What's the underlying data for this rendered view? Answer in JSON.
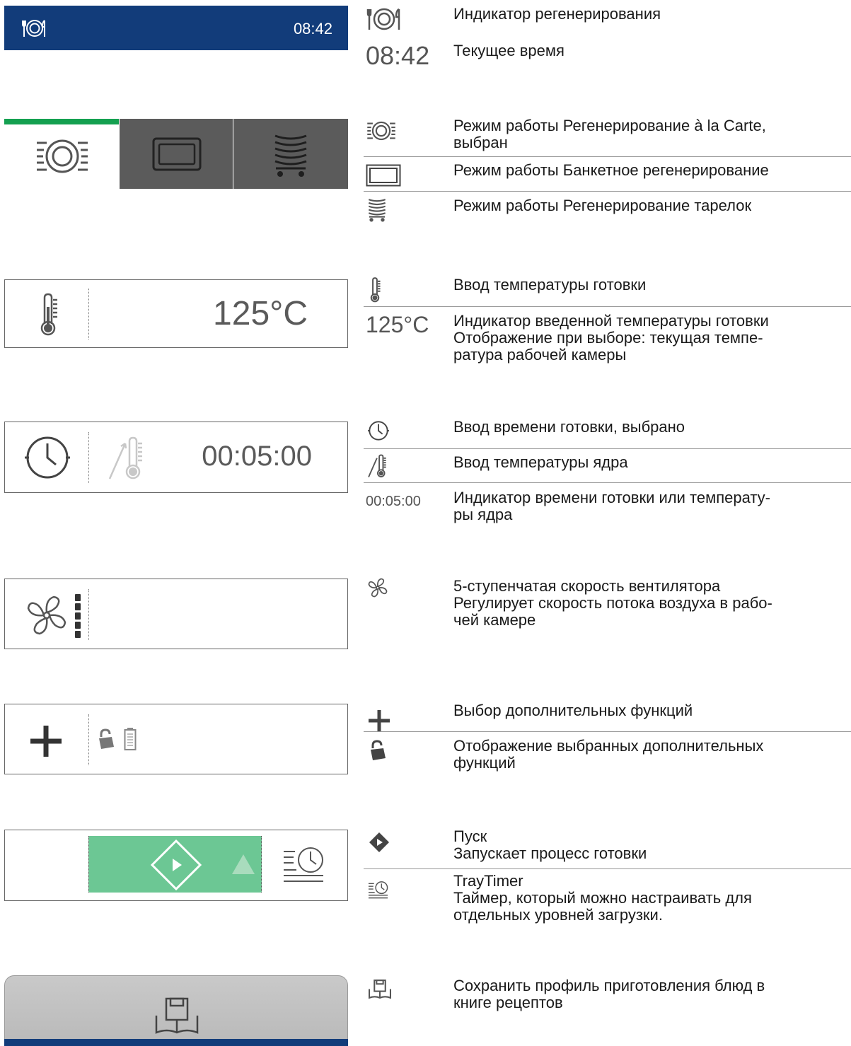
{
  "header": {
    "time": "08:42",
    "icon": "plate-cutlery-icon"
  },
  "temperature_panel": {
    "value": "125°C"
  },
  "time_panel": {
    "value": "00:05:00"
  },
  "legend": {
    "regen_indicator": "Индикатор регенерирования",
    "current_time_value": "08:42",
    "current_time": "Текущее время",
    "mode_alacarte": "Режим работы Регенерирование à la Carte,\nвыбран",
    "mode_banquet": "Режим работы Банкетное регенерирование",
    "mode_plate": "Режим работы Регенерирование тарелок",
    "temp_input": "Ввод температуры готовки",
    "temp_value": "125°C",
    "temp_indicator": "Индикатор введенной температуры готовки\nОтображение при выборе: текущая темпе-\nратура рабочей камеры",
    "time_input": "Ввод времени готовки, выбрано",
    "core_temp_input": "Ввод температуры ядра",
    "time_value": "00:05:00",
    "time_indicator": "Индикатор времени готовки или температу-\nры ядра",
    "fan_speed": "5-ступенчатая скорость вентилятора\nРегулирует скорость потока воздуха в рабо-\nчей камере",
    "extra_select": "Выбор дополнительных функций",
    "extra_display": "Отображение выбранных дополнительных\nфункций",
    "start": "Пуск\nЗапускает процесс готовки",
    "traytimer": "TrayTimer\nТаймер, который можно настраивать для\nотдельных уровней загрузки.",
    "save": "Сохранить профиль приготовления блюд в\nкниге рецептов"
  },
  "colors": {
    "header_blue": "#123c7a",
    "selected_green": "#14a050",
    "start_green": "#6cc794",
    "tab_gray": "#5b5b5b"
  },
  "fan_speed_level": 5,
  "fan_speed_max": 5
}
